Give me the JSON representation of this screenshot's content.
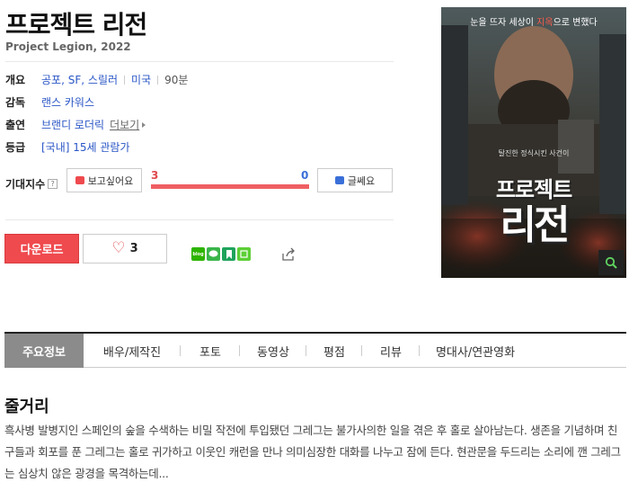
{
  "movie": {
    "title": "프로젝트 리전",
    "subtitle": "Project Legion, 2022"
  },
  "info": {
    "overview_label": "개요",
    "genres": [
      "공포",
      "SF",
      "스릴러"
    ],
    "country": "미국",
    "runtime": "90분",
    "director_label": "감독",
    "director": "랜스 카워스",
    "cast_label": "출연",
    "cast": "브랜디 로더릭",
    "more_label": "더보기",
    "rating_label": "등급",
    "rating": "[국내] 15세 관람가"
  },
  "expectation": {
    "label": "기대지수",
    "help": "?",
    "want_label": "보고싶어요",
    "meh_label": "글쎄요",
    "want_count": "3",
    "meh_count": "0",
    "want_ratio": 1.0,
    "want_color": "#ef5f63",
    "meh_color": "#3a6fd8"
  },
  "actions": {
    "download_label": "다운로드",
    "like_count": "3",
    "accent": "#ef4a4e"
  },
  "share": {
    "icons": [
      "blog-icon",
      "kakao-icon",
      "bookmark-icon",
      "line-icon"
    ],
    "share_icon": "share-icon"
  },
  "poster": {
    "tagline_a": "눈을 뜨자 세상이 ",
    "tagline_b": "지옥",
    "tagline_c": "으로 변했다",
    "small_text": "탈진한 정식시킨 사건이",
    "title_line1": "프로젝트",
    "title_line2": "리전",
    "zoom_icon": "search-icon"
  },
  "tabs": [
    {
      "label": "주요정보",
      "active": true
    },
    {
      "label": "배우/제작진",
      "active": false
    },
    {
      "label": "포토",
      "active": false
    },
    {
      "label": "동영상",
      "active": false
    },
    {
      "label": "평점",
      "active": false
    },
    {
      "label": "리뷰",
      "active": false
    },
    {
      "label": "명대사/연관영화",
      "active": false
    }
  ],
  "plot": {
    "heading": "줄거리",
    "text": "흑사병 발병지인 스페인의 숲을 수색하는 비밀 작전에 투입됐던 그레그는 불가사의한 일을 겪은 후 홀로 살아남는다. 생존을 기념하며 친구들과 회포를 푼 그레그는 홀로 귀가하고 이웃인 캐런을 만나 의미심장한 대화를 나누고 잠에 든다. 현관문을 두드리는 소리에 깬 그레그는 심상치 않은 광경을 목격하는데..."
  }
}
